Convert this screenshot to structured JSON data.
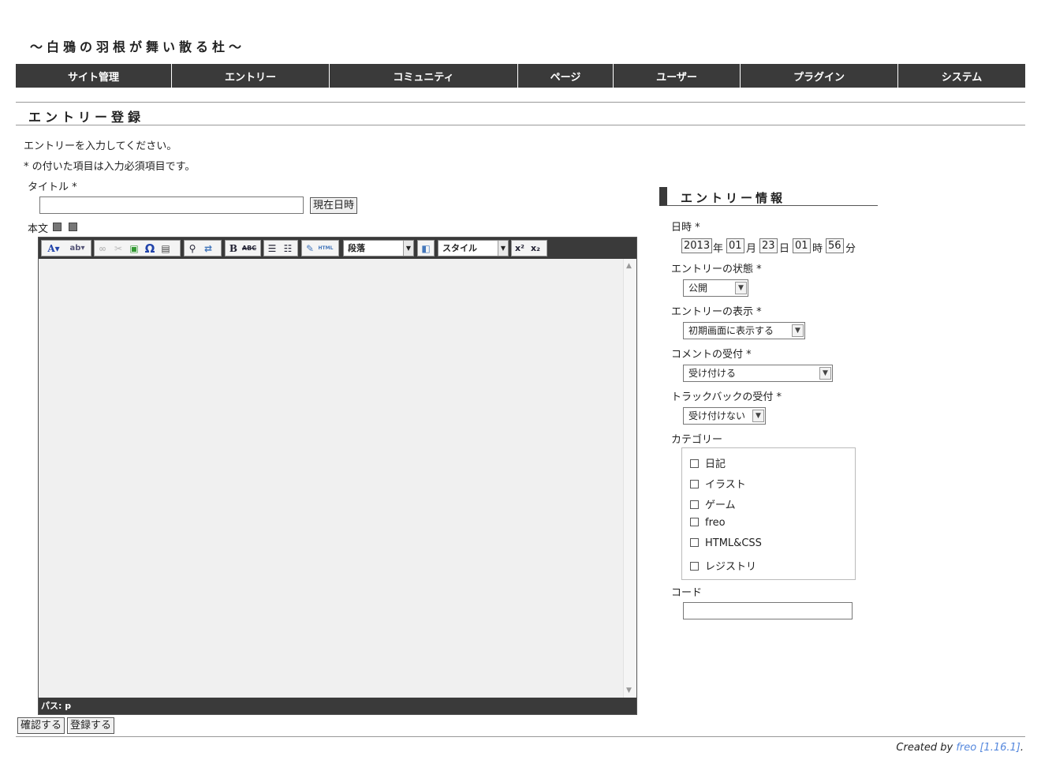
{
  "site": {
    "title": "〜白鴉の羽根が舞い散る杜〜"
  },
  "nav": {
    "items": [
      "サイト管理",
      "エントリー",
      "コミュニティ",
      "ページ",
      "ユーザー",
      "プラグイン",
      "システム"
    ]
  },
  "page": {
    "title": "エントリー登録"
  },
  "form": {
    "intro": "エントリーを入力してください。",
    "required_note": "* の付いた項目は入力必須項目です。",
    "title_label": "タイトル *",
    "title_value": "",
    "now_button": "現在日時",
    "body_label": "本文",
    "confirm_button": "確認する",
    "submit_button": "登録する"
  },
  "editor": {
    "format_select": "段落",
    "style_select": "スタイル",
    "path": "パス: p",
    "toolbar_icons": [
      "font-color-icon",
      "highlight-icon",
      "link-icon",
      "unlink-icon",
      "image-icon",
      "omega-icon",
      "table-icon",
      "find-icon",
      "replace-icon",
      "bold-icon",
      "strike-icon",
      "bullet-list-icon",
      "number-list-icon",
      "edit-icon",
      "html-icon",
      "layout-icon",
      "superscript-icon",
      "subscript-icon"
    ]
  },
  "sidebar": {
    "title": "エントリー情報",
    "datetime_label": "日時 *",
    "datetime": {
      "year": "2013",
      "year_unit": "年",
      "month": "01",
      "month_unit": "月",
      "day": "23",
      "day_unit": "日",
      "hour": "01",
      "hour_unit": "時",
      "minute": "56",
      "minute_unit": "分"
    },
    "status_label": "エントリーの状態 *",
    "status_value": "公開",
    "display_label": "エントリーの表示 *",
    "display_value": "初期画面に表示する",
    "comment_label": "コメントの受付 *",
    "comment_value": "受け付ける",
    "trackback_label": "トラックバックの受付 *",
    "trackback_value": "受け付けない",
    "category_label": "カテゴリー",
    "categories": [
      "日記",
      "イラスト",
      "ゲーム",
      "freo",
      "HTML&CSS",
      "レジストリ"
    ],
    "code_label": "コード",
    "code_value": ""
  },
  "footer": {
    "prefix": "Created by ",
    "link": "freo [1.16.1]",
    "suffix": "."
  }
}
